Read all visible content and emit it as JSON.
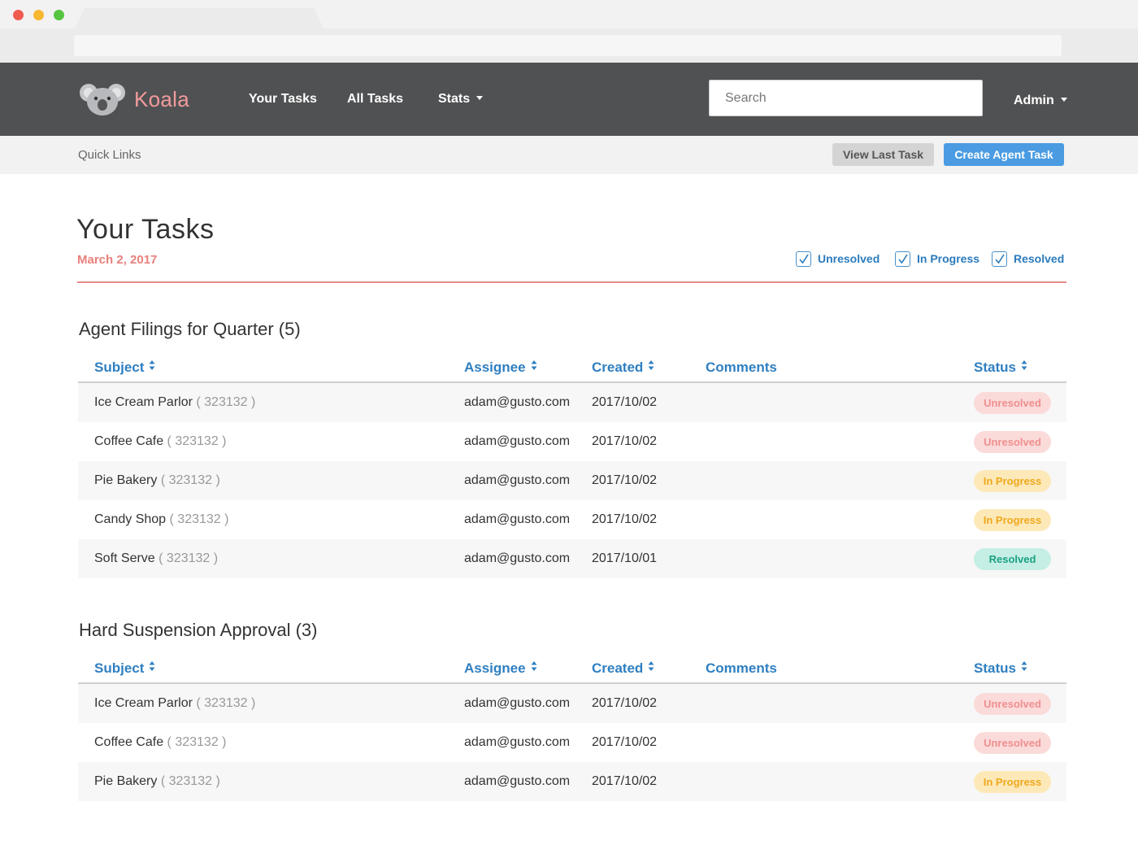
{
  "app": {
    "brand": "Koala",
    "nav": {
      "your_tasks": "Your Tasks",
      "all_tasks": "All Tasks",
      "stats": "Stats"
    },
    "search_placeholder": "Search",
    "user_menu": "Admin"
  },
  "quickbar": {
    "label": "Quick Links",
    "view_last": "View Last Task",
    "create": "Create Agent Task"
  },
  "page": {
    "title": "Your Tasks",
    "date": "March 2, 2017",
    "filters": [
      "Unresolved",
      "In Progress",
      "Resolved"
    ]
  },
  "columns": {
    "subject": "Subject",
    "assignee": "Assignee",
    "created": "Created",
    "comments": "Comments",
    "status": "Status"
  },
  "sections": [
    {
      "title": "Agent Filings for Quarter (5)",
      "rows": [
        {
          "name": "Ice Cream Parlor",
          "id": "( 323132 )",
          "assignee": "adam@gusto.com",
          "created": "2017/10/02",
          "comments": "",
          "status": "Unresolved"
        },
        {
          "name": "Coffee Cafe",
          "id": "( 323132 )",
          "assignee": "adam@gusto.com",
          "created": "2017/10/02",
          "comments": "",
          "status": "Unresolved"
        },
        {
          "name": "Pie Bakery",
          "id": "( 323132 )",
          "assignee": "adam@gusto.com",
          "created": "2017/10/02",
          "comments": "",
          "status": "In Progress"
        },
        {
          "name": "Candy Shop",
          "id": "( 323132 )",
          "assignee": "adam@gusto.com",
          "created": "2017/10/02",
          "comments": "",
          "status": "In Progress"
        },
        {
          "name": "Soft Serve",
          "id": "( 323132 )",
          "assignee": "adam@gusto.com",
          "created": "2017/10/01",
          "comments": "",
          "status": "Resolved"
        }
      ]
    },
    {
      "title": "Hard Suspension Approval (3)",
      "rows": [
        {
          "name": "Ice Cream Parlor",
          "id": "( 323132 )",
          "assignee": "adam@gusto.com",
          "created": "2017/10/02",
          "comments": "",
          "status": "Unresolved"
        },
        {
          "name": "Coffee Cafe",
          "id": "( 323132 )",
          "assignee": "adam@gusto.com",
          "created": "2017/10/02",
          "comments": "",
          "status": "Unresolved"
        },
        {
          "name": "Pie Bakery",
          "id": "( 323132 )",
          "assignee": "adam@gusto.com",
          "created": "2017/10/02",
          "comments": "",
          "status": "In Progress"
        }
      ]
    }
  ],
  "colors": {
    "navbar": "#505153",
    "brand": "#f29b9b",
    "accent_blue": "#4a9be2",
    "link_blue": "#2f7fc1",
    "date_pink": "#e8807c",
    "unresolved": "#f08f8f",
    "in_progress": "#f0a81d",
    "resolved": "#1aa283"
  },
  "icons": [
    "koala-logo",
    "caret-down-icon",
    "sort-icon",
    "checkbox-checked-icon"
  ]
}
